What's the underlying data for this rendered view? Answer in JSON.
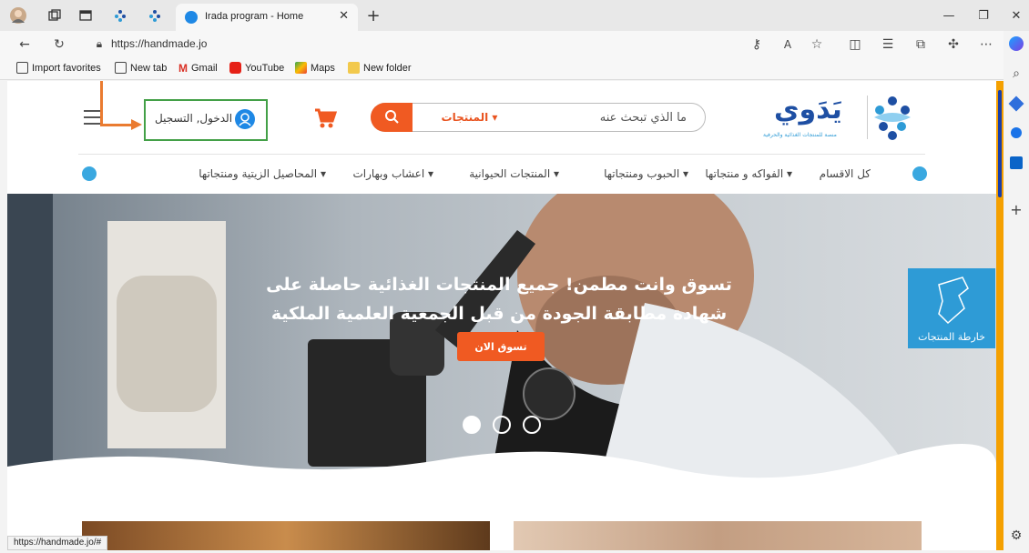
{
  "browser": {
    "tab_title": "Irada program - Home",
    "url": "https://handmade.jo",
    "favorites": [
      "Import favorites",
      "New tab",
      "Gmail",
      "YouTube",
      "Maps",
      "New folder"
    ],
    "status_url": "https://handmade.jo/#"
  },
  "header": {
    "search_placeholder": "ما الذي تبحث عنه",
    "search_category": "المنتجات ▾",
    "login_label": "الدخول, التسجيل",
    "logo_text": "يَدَوي",
    "logo_subtitle": "منصة للمنتجات الغذائية والحرفية"
  },
  "category_nav": [
    "كل الاقسام",
    "الفواكه و منتجاتها ▾",
    "الحبوب ومنتجاتها ▾",
    "المنتجات الحيوانية ▾",
    "اعشاب وبهارات ▾",
    "المحاصيل الزيتية ومنتجاتها ▾"
  ],
  "hero": {
    "headline_line1": "تسوق وانت مطمن! جميع المنتجات الغذائية حاصلة على",
    "headline_line2": "شهادة مطابقة الجودة من قبل الجمعية العلمية الملكية",
    "cta": "تسوق الان",
    "map_badge": "خارطة المنتجات",
    "slides_total": 3,
    "active_slide": 1
  },
  "colors": {
    "accent_orange": "#f05a22",
    "brand_blue": "#2e9bd6",
    "login_border_green": "#43a047",
    "annotation_orange": "#ea7b30"
  }
}
